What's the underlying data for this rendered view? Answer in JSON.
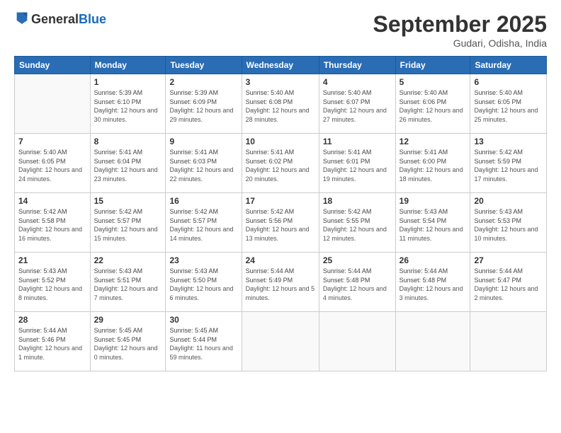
{
  "logo": {
    "general": "General",
    "blue": "Blue"
  },
  "header": {
    "month": "September 2025",
    "location": "Gudari, Odisha, India"
  },
  "weekdays": [
    "Sunday",
    "Monday",
    "Tuesday",
    "Wednesday",
    "Thursday",
    "Friday",
    "Saturday"
  ],
  "weeks": [
    [
      {
        "day": "",
        "sunrise": "",
        "sunset": "",
        "daylight": ""
      },
      {
        "day": "1",
        "sunrise": "Sunrise: 5:39 AM",
        "sunset": "Sunset: 6:10 PM",
        "daylight": "Daylight: 12 hours and 30 minutes."
      },
      {
        "day": "2",
        "sunrise": "Sunrise: 5:39 AM",
        "sunset": "Sunset: 6:09 PM",
        "daylight": "Daylight: 12 hours and 29 minutes."
      },
      {
        "day": "3",
        "sunrise": "Sunrise: 5:40 AM",
        "sunset": "Sunset: 6:08 PM",
        "daylight": "Daylight: 12 hours and 28 minutes."
      },
      {
        "day": "4",
        "sunrise": "Sunrise: 5:40 AM",
        "sunset": "Sunset: 6:07 PM",
        "daylight": "Daylight: 12 hours and 27 minutes."
      },
      {
        "day": "5",
        "sunrise": "Sunrise: 5:40 AM",
        "sunset": "Sunset: 6:06 PM",
        "daylight": "Daylight: 12 hours and 26 minutes."
      },
      {
        "day": "6",
        "sunrise": "Sunrise: 5:40 AM",
        "sunset": "Sunset: 6:05 PM",
        "daylight": "Daylight: 12 hours and 25 minutes."
      }
    ],
    [
      {
        "day": "7",
        "sunrise": "Sunrise: 5:40 AM",
        "sunset": "Sunset: 6:05 PM",
        "daylight": "Daylight: 12 hours and 24 minutes."
      },
      {
        "day": "8",
        "sunrise": "Sunrise: 5:41 AM",
        "sunset": "Sunset: 6:04 PM",
        "daylight": "Daylight: 12 hours and 23 minutes."
      },
      {
        "day": "9",
        "sunrise": "Sunrise: 5:41 AM",
        "sunset": "Sunset: 6:03 PM",
        "daylight": "Daylight: 12 hours and 22 minutes."
      },
      {
        "day": "10",
        "sunrise": "Sunrise: 5:41 AM",
        "sunset": "Sunset: 6:02 PM",
        "daylight": "Daylight: 12 hours and 20 minutes."
      },
      {
        "day": "11",
        "sunrise": "Sunrise: 5:41 AM",
        "sunset": "Sunset: 6:01 PM",
        "daylight": "Daylight: 12 hours and 19 minutes."
      },
      {
        "day": "12",
        "sunrise": "Sunrise: 5:41 AM",
        "sunset": "Sunset: 6:00 PM",
        "daylight": "Daylight: 12 hours and 18 minutes."
      },
      {
        "day": "13",
        "sunrise": "Sunrise: 5:42 AM",
        "sunset": "Sunset: 5:59 PM",
        "daylight": "Daylight: 12 hours and 17 minutes."
      }
    ],
    [
      {
        "day": "14",
        "sunrise": "Sunrise: 5:42 AM",
        "sunset": "Sunset: 5:58 PM",
        "daylight": "Daylight: 12 hours and 16 minutes."
      },
      {
        "day": "15",
        "sunrise": "Sunrise: 5:42 AM",
        "sunset": "Sunset: 5:57 PM",
        "daylight": "Daylight: 12 hours and 15 minutes."
      },
      {
        "day": "16",
        "sunrise": "Sunrise: 5:42 AM",
        "sunset": "Sunset: 5:57 PM",
        "daylight": "Daylight: 12 hours and 14 minutes."
      },
      {
        "day": "17",
        "sunrise": "Sunrise: 5:42 AM",
        "sunset": "Sunset: 5:56 PM",
        "daylight": "Daylight: 12 hours and 13 minutes."
      },
      {
        "day": "18",
        "sunrise": "Sunrise: 5:42 AM",
        "sunset": "Sunset: 5:55 PM",
        "daylight": "Daylight: 12 hours and 12 minutes."
      },
      {
        "day": "19",
        "sunrise": "Sunrise: 5:43 AM",
        "sunset": "Sunset: 5:54 PM",
        "daylight": "Daylight: 12 hours and 11 minutes."
      },
      {
        "day": "20",
        "sunrise": "Sunrise: 5:43 AM",
        "sunset": "Sunset: 5:53 PM",
        "daylight": "Daylight: 12 hours and 10 minutes."
      }
    ],
    [
      {
        "day": "21",
        "sunrise": "Sunrise: 5:43 AM",
        "sunset": "Sunset: 5:52 PM",
        "daylight": "Daylight: 12 hours and 8 minutes."
      },
      {
        "day": "22",
        "sunrise": "Sunrise: 5:43 AM",
        "sunset": "Sunset: 5:51 PM",
        "daylight": "Daylight: 12 hours and 7 minutes."
      },
      {
        "day": "23",
        "sunrise": "Sunrise: 5:43 AM",
        "sunset": "Sunset: 5:50 PM",
        "daylight": "Daylight: 12 hours and 6 minutes."
      },
      {
        "day": "24",
        "sunrise": "Sunrise: 5:44 AM",
        "sunset": "Sunset: 5:49 PM",
        "daylight": "Daylight: 12 hours and 5 minutes."
      },
      {
        "day": "25",
        "sunrise": "Sunrise: 5:44 AM",
        "sunset": "Sunset: 5:48 PM",
        "daylight": "Daylight: 12 hours and 4 minutes."
      },
      {
        "day": "26",
        "sunrise": "Sunrise: 5:44 AM",
        "sunset": "Sunset: 5:48 PM",
        "daylight": "Daylight: 12 hours and 3 minutes."
      },
      {
        "day": "27",
        "sunrise": "Sunrise: 5:44 AM",
        "sunset": "Sunset: 5:47 PM",
        "daylight": "Daylight: 12 hours and 2 minutes."
      }
    ],
    [
      {
        "day": "28",
        "sunrise": "Sunrise: 5:44 AM",
        "sunset": "Sunset: 5:46 PM",
        "daylight": "Daylight: 12 hours and 1 minute."
      },
      {
        "day": "29",
        "sunrise": "Sunrise: 5:45 AM",
        "sunset": "Sunset: 5:45 PM",
        "daylight": "Daylight: 12 hours and 0 minutes."
      },
      {
        "day": "30",
        "sunrise": "Sunrise: 5:45 AM",
        "sunset": "Sunset: 5:44 PM",
        "daylight": "Daylight: 11 hours and 59 minutes."
      },
      {
        "day": "",
        "sunrise": "",
        "sunset": "",
        "daylight": ""
      },
      {
        "day": "",
        "sunrise": "",
        "sunset": "",
        "daylight": ""
      },
      {
        "day": "",
        "sunrise": "",
        "sunset": "",
        "daylight": ""
      },
      {
        "day": "",
        "sunrise": "",
        "sunset": "",
        "daylight": ""
      }
    ]
  ]
}
